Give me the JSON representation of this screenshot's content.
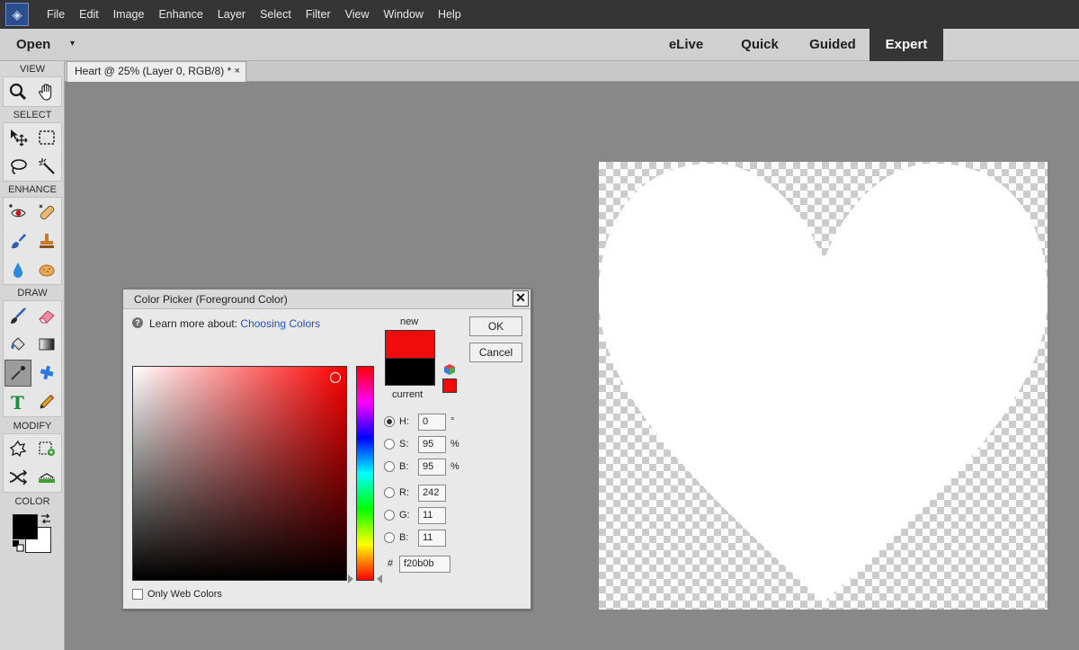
{
  "menubar": {
    "logo_icon": "photoshop-elements-logo-icon",
    "items": [
      "File",
      "Edit",
      "Image",
      "Enhance",
      "Layer",
      "Select",
      "Filter",
      "View",
      "Window",
      "Help"
    ]
  },
  "modebar": {
    "open_label": "Open",
    "open_arrow": "▾",
    "tabs": [
      "eLive",
      "Quick",
      "Guided",
      "Expert"
    ],
    "active_tab": "Expert"
  },
  "document": {
    "tab_title": "Heart @ 25% (Layer 0, RGB/8) *",
    "close_glyph": "×"
  },
  "toolbox": {
    "sections": [
      "VIEW",
      "SELECT",
      "ENHANCE",
      "DRAW",
      "MODIFY",
      "COLOR"
    ],
    "view_tools": [
      "zoom-tool-icon",
      "hand-tool-icon"
    ],
    "select_tools": [
      "move-tool-icon",
      "marquee-tool-icon",
      "lasso-tool-icon",
      "quick-selection-tool-icon"
    ],
    "enhance_tools": [
      "red-eye-tool-icon",
      "spot-healing-tool-icon",
      "smart-brush-tool-icon",
      "clone-stamp-tool-icon",
      "blur-tool-icon",
      "sponge-tool-icon"
    ],
    "draw_tools": [
      "brush-tool-icon",
      "eraser-tool-icon",
      "paint-bucket-tool-icon",
      "gradient-tool-icon",
      "color-picker-tool-icon",
      "custom-shape-tool-icon",
      "type-tool-icon",
      "pencil-tool-icon"
    ],
    "modify_tools": [
      "crop-tool-icon",
      "recompose-tool-icon",
      "content-aware-move-tool-icon",
      "straighten-tool-icon"
    ],
    "foreground_color": "#000000",
    "background_color": "#ffffff"
  },
  "color_picker": {
    "title": "Color Picker (Foreground Color)",
    "close_glyph": "✕",
    "help_glyph": "?",
    "learn_more": "Learn more about: ",
    "learn_link": "Choosing Colors",
    "new_label": "new",
    "current_label": "current",
    "new_color": "#f20b0b",
    "current_color": "#000000",
    "ok_label": "OK",
    "cancel_label": "Cancel",
    "fields": [
      {
        "label": "H:",
        "value": "0",
        "unit": "°",
        "checked": true
      },
      {
        "label": "S:",
        "value": "95",
        "unit": "%",
        "checked": false
      },
      {
        "label": "B:",
        "value": "95",
        "unit": "%",
        "checked": false
      },
      {
        "label": "R:",
        "value": "242",
        "unit": "",
        "checked": false
      },
      {
        "label": "G:",
        "value": "11",
        "unit": "",
        "checked": false
      },
      {
        "label": "B:",
        "value": "11",
        "unit": "",
        "checked": false
      }
    ],
    "hex_label": "#",
    "hex_value": "f20b0b",
    "only_web_colors": "Only Web Colors"
  }
}
